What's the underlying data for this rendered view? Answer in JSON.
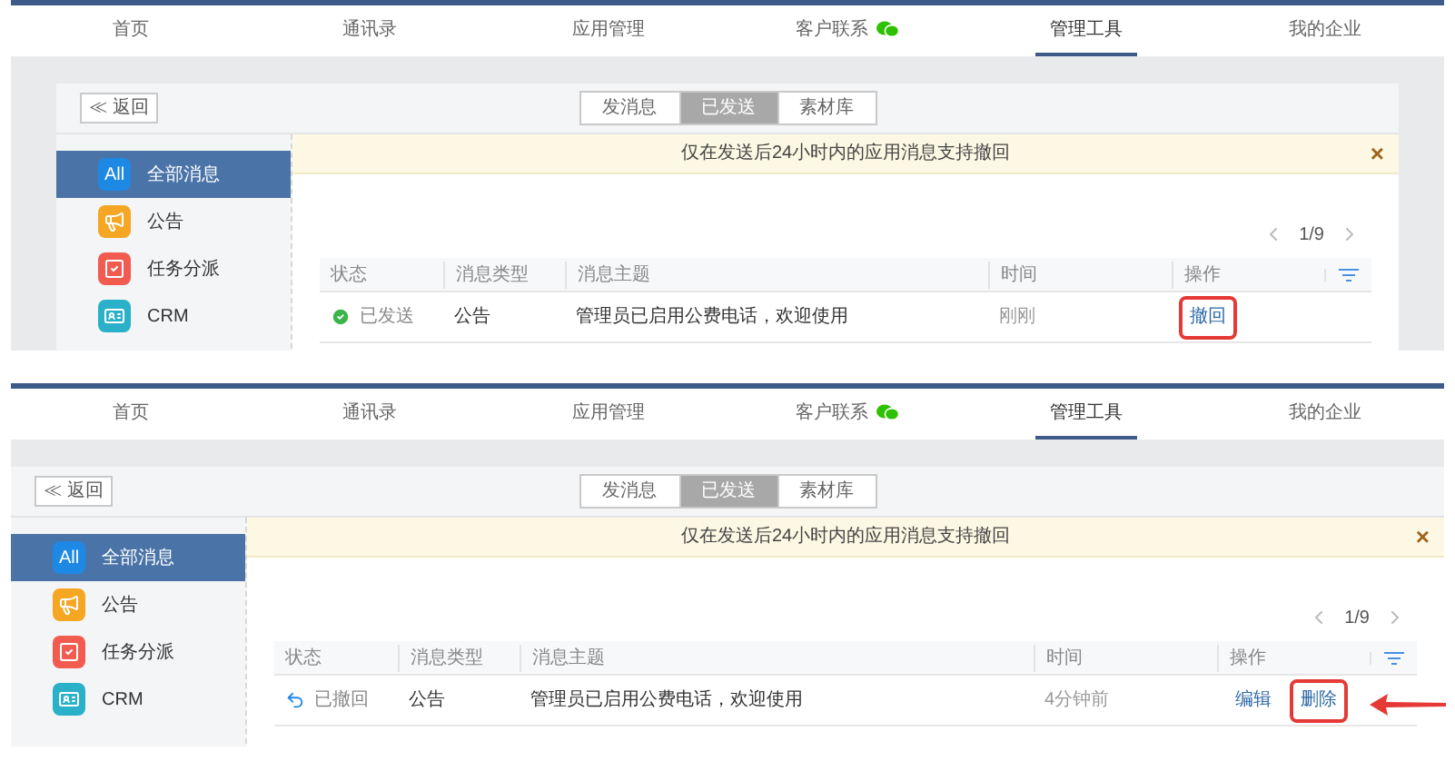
{
  "panels": [
    {
      "nav": [
        {
          "label": "首页",
          "selected": false
        },
        {
          "label": "通讯录",
          "selected": false
        },
        {
          "label": "应用管理",
          "selected": false
        },
        {
          "label": "客户联系",
          "selected": false,
          "chat_icon": true
        },
        {
          "label": "管理工具",
          "selected": true
        },
        {
          "label": "我的企业",
          "selected": false
        }
      ],
      "back_button": "≪ 返回",
      "segments": [
        {
          "label": "发消息",
          "selected": false
        },
        {
          "label": "已发送",
          "selected": true
        },
        {
          "label": "素材库",
          "selected": false
        }
      ],
      "sidebar": [
        {
          "label": "全部消息",
          "selected": true,
          "kind": "all",
          "badge": "All"
        },
        {
          "label": "公告",
          "selected": false,
          "kind": "notice"
        },
        {
          "label": "任务分派",
          "selected": false,
          "kind": "task"
        },
        {
          "label": "CRM",
          "selected": false,
          "kind": "crm"
        }
      ],
      "notice": "仅在发送后24小时内的应用消息支持撤回",
      "close": "×",
      "pager": "1/9",
      "columns": [
        "状态",
        "消息类型",
        "消息主题",
        "时间",
        "操作"
      ],
      "rows": [
        {
          "status": "已发送",
          "kind": "sent",
          "type": "公告",
          "subject": "管理员已启用公费电话，欢迎使用",
          "time": "刚刚",
          "actions": [
            {
              "label": "撤回",
              "highlighted": true
            }
          ]
        }
      ]
    },
    {
      "nav": [
        {
          "label": "首页",
          "selected": false
        },
        {
          "label": "通讯录",
          "selected": false
        },
        {
          "label": "应用管理",
          "selected": false
        },
        {
          "label": "客户联系",
          "selected": false,
          "chat_icon": true
        },
        {
          "label": "管理工具",
          "selected": true
        },
        {
          "label": "我的企业",
          "selected": false
        }
      ],
      "back_button": "≪ 返回",
      "segments": [
        {
          "label": "发消息",
          "selected": false
        },
        {
          "label": "已发送",
          "selected": true
        },
        {
          "label": "素材库",
          "selected": false
        }
      ],
      "sidebar": [
        {
          "label": "全部消息",
          "selected": true,
          "kind": "all",
          "badge": "All"
        },
        {
          "label": "公告",
          "selected": false,
          "kind": "notice"
        },
        {
          "label": "任务分派",
          "selected": false,
          "kind": "task"
        },
        {
          "label": "CRM",
          "selected": false,
          "kind": "crm"
        }
      ],
      "notice": "仅在发送后24小时内的应用消息支持撤回",
      "close": "×",
      "pager": "1/9",
      "columns": [
        "状态",
        "消息类型",
        "消息主题",
        "时间",
        "操作"
      ],
      "rows": [
        {
          "status": "已撤回",
          "kind": "recalled",
          "type": "公告",
          "subject": "管理员已启用公费电话，欢迎使用",
          "time": "4分钟前",
          "actions": [
            {
              "label": "编辑",
              "highlighted": false
            },
            {
              "label": "删除",
              "highlighted": true
            }
          ]
        }
      ],
      "pointer_arrow": true
    }
  ]
}
